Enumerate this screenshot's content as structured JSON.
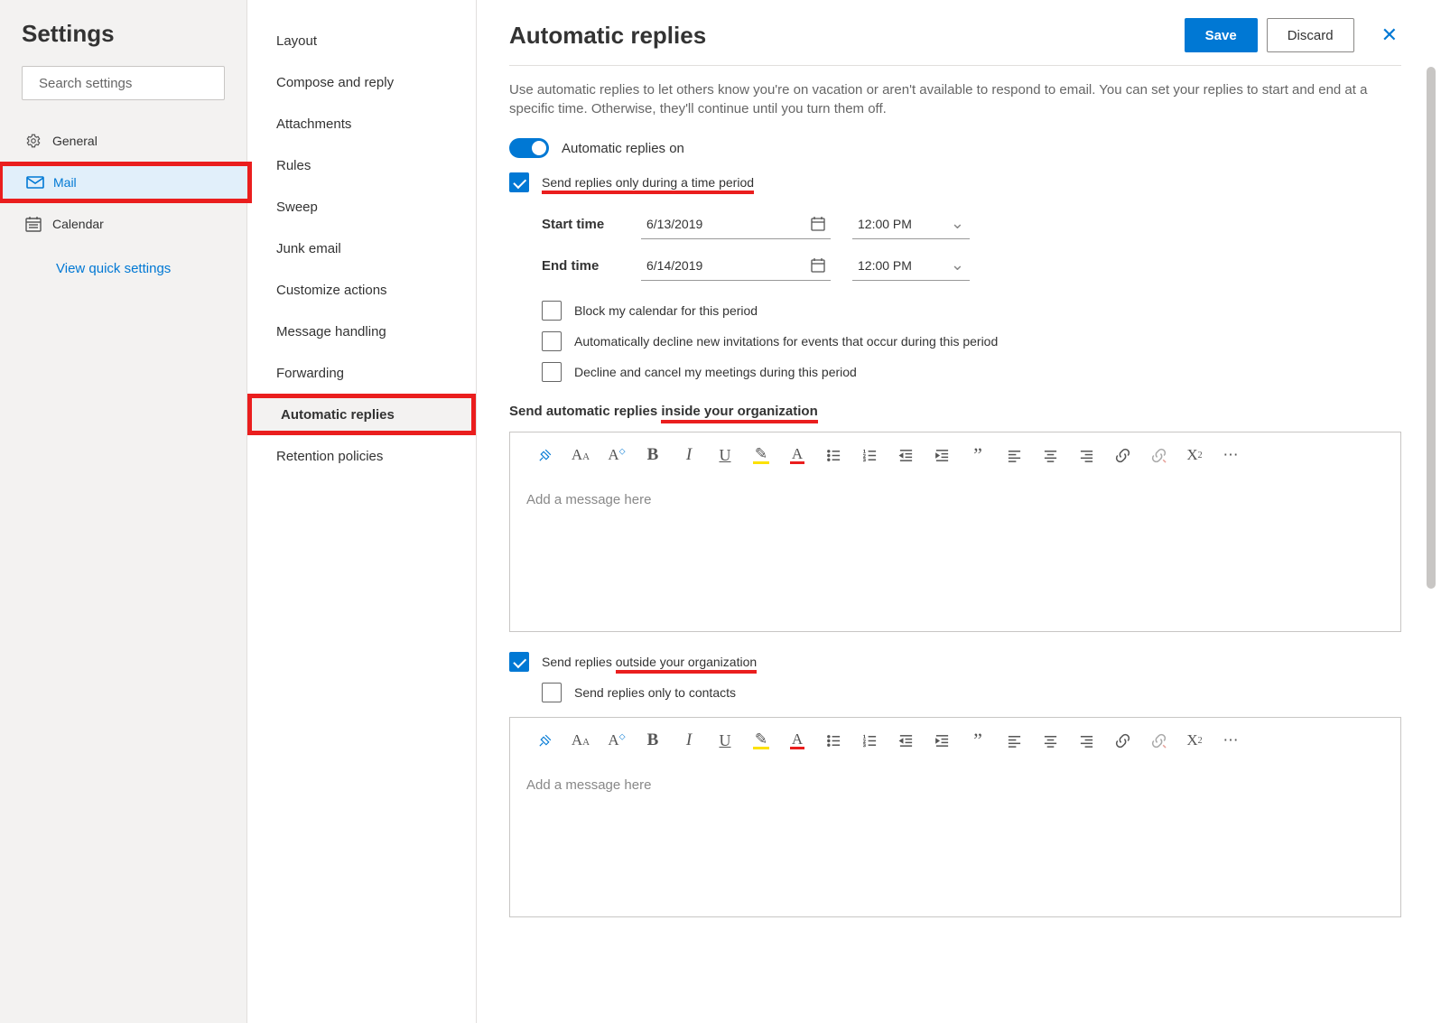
{
  "sidebar": {
    "title": "Settings",
    "search_placeholder": "Search settings",
    "items": [
      {
        "label": "General"
      },
      {
        "label": "Mail"
      },
      {
        "label": "Calendar"
      }
    ],
    "quick": "View quick settings"
  },
  "subnav": {
    "items": [
      "Layout",
      "Compose and reply",
      "Attachments",
      "Rules",
      "Sweep",
      "Junk email",
      "Customize actions",
      "Message handling",
      "Forwarding",
      "Automatic replies",
      "Retention policies"
    ]
  },
  "header": {
    "title": "Automatic replies",
    "save": "Save",
    "discard": "Discard"
  },
  "desc": "Use automatic replies to let others know you're on vacation or aren't available to respond to email. You can set your replies to start and end at a specific time. Otherwise, they'll continue until you turn them off.",
  "toggle_label": "Automatic replies on",
  "send_period": {
    "prefix": "Send replies only during a time period",
    "start_label": "Start time",
    "start_date": "6/13/2019",
    "start_time": "12:00 PM",
    "end_label": "End time",
    "end_date": "6/14/2019",
    "end_time": "12:00 PM"
  },
  "period_options": [
    "Block my calendar for this period",
    "Automatically decline new invitations for events that occur during this period",
    "Decline and cancel my meetings during this period"
  ],
  "inside_heading_prefix": "Send automatic replies ",
  "inside_heading_accent": "inside your organization",
  "editor_placeholder": "Add a message here",
  "outside": {
    "prefix": "Send replies ",
    "accent": "outside your organization",
    "contacts_only": "Send replies only to contacts"
  },
  "icons": {
    "brush": "format-painter-icon",
    "font": "font-icon",
    "fontsize": "font-size-icon",
    "bold": "bold-icon",
    "italic": "italic-icon",
    "underline": "underline-icon",
    "highlight": "highlight-icon",
    "fontcolor": "font-color-icon",
    "bullets": "bullets-icon",
    "numbering": "numbering-icon",
    "outdent": "decrease-indent-icon",
    "indent": "increase-indent-icon",
    "quote": "quote-icon",
    "left": "align-left-icon",
    "center": "align-center-icon",
    "right": "align-right-icon",
    "link": "link-icon",
    "unlink": "unlink-icon",
    "super": "superscript-icon",
    "more": "more-icon"
  }
}
